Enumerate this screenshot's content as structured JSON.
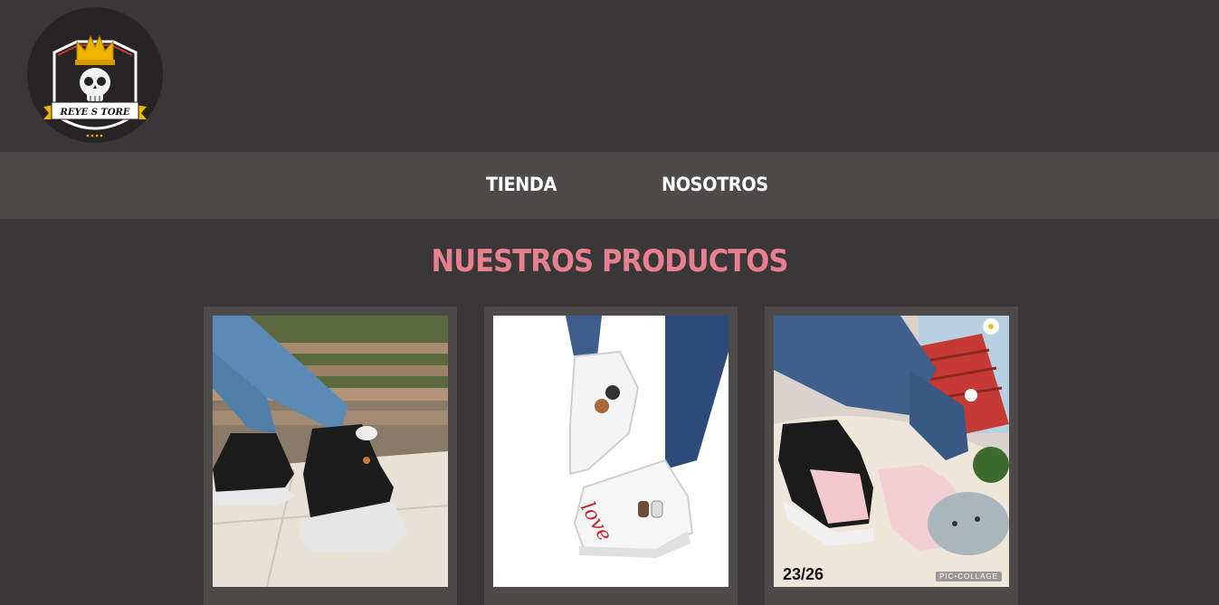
{
  "brand": {
    "logo_text": "REYE S TORE",
    "logo_icon": "crowned-skull-icon"
  },
  "nav": {
    "items": [
      {
        "label": "TIENDA"
      },
      {
        "label": "NOSOTROS"
      }
    ]
  },
  "main": {
    "title": "NUESTROS PRODUCTOS",
    "products": [
      {
        "image": "black-high-top-sneaker"
      },
      {
        "image": "white-love-print-sneaker"
      },
      {
        "image": "black-pink-chunky-sneaker",
        "size_tag": "23/26",
        "watermark": "PIC•COLLAGE"
      }
    ]
  },
  "colors": {
    "background": "#3a3738",
    "nav_bar": "#4d4a4a",
    "title_accent": "#e8818f",
    "nav_text": "#ffffff"
  }
}
